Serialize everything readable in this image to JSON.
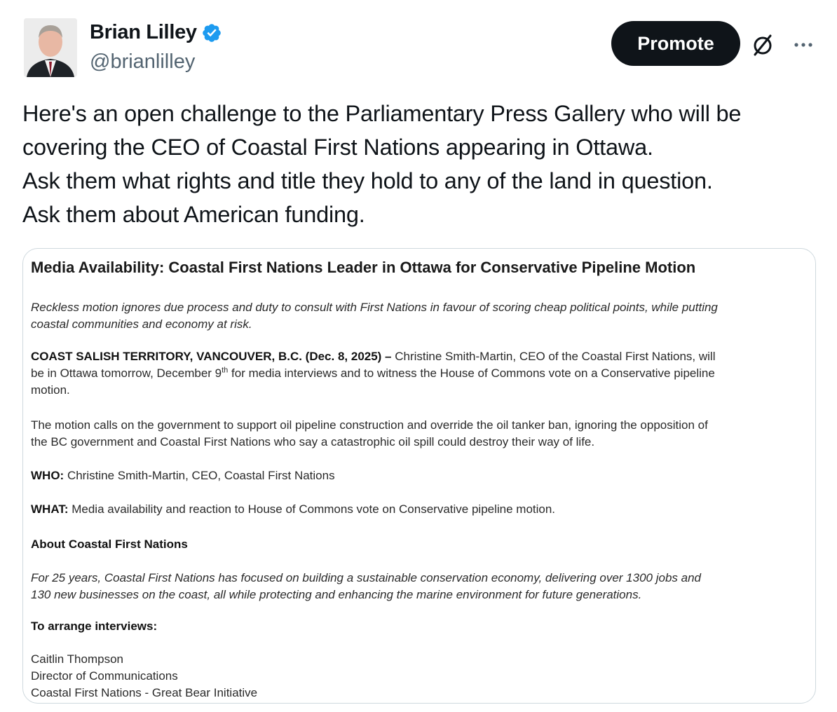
{
  "author": {
    "name": "Brian Lilley",
    "handle": "@brianlilley",
    "verified_color": "#1d9bf0"
  },
  "actions": {
    "promote_label": "Promote",
    "grok_icon": "slashed-circle-icon",
    "more_icon": "more-dots-icon"
  },
  "tweet": {
    "lines": [
      "Here's an open challenge to the Parliamentary Press Gallery who will be",
      "covering the CEO of Coastal First Nations appearing in Ottawa.",
      "Ask them what rights and title they hold to any of the land in question.",
      "Ask them about American funding."
    ]
  },
  "document": {
    "title": "Media Availability: Coastal First Nations Leader in Ottawa for Conservative Pipeline Motion",
    "subtitle_lines": [
      "Reckless motion ignores due process and duty to consult with First Nations in favour of scoring cheap political points, while putting",
      "coastal communities and economy at risk."
    ],
    "dateline_bold": "COAST SALISH TERRITORY, VANCOUVER, B.C. (Dec. 8, 2025) –",
    "dateline_rest_1": " Christine Smith-Martin, CEO of the Coastal First Nations, will",
    "dateline_line2_a": "be in Ottawa tomorrow, December 9",
    "dateline_sup": "th",
    "dateline_line2_b": " for media interviews and to witness the House of Commons vote on a Conservative pipeline",
    "dateline_line3": "motion.",
    "motion_lines": [
      "The motion calls on the government to support oil pipeline construction and override the oil tanker ban, ignoring the opposition of",
      "the BC government and Coastal First Nations who say a catastrophic oil spill could destroy their way of life."
    ],
    "who_label": "WHO:",
    "who_value": " Christine Smith-Martin, CEO, Coastal First Nations",
    "what_label": "WHAT:",
    "what_value": " Media availability and reaction to House of Commons vote on Conservative pipeline motion.",
    "about_heading": "About Coastal First Nations",
    "about_lines": [
      "For 25 years, Coastal First Nations has focused on building a sustainable conservation economy, delivering over 1300 jobs and",
      "130 new businesses on the coast, all while protecting and enhancing the marine environment for future generations."
    ],
    "arrange_heading": "To arrange interviews:",
    "contact_lines": [
      "Caitlin Thompson",
      "Director of Communications",
      "Coastal First Nations - Great Bear Initiative"
    ]
  }
}
